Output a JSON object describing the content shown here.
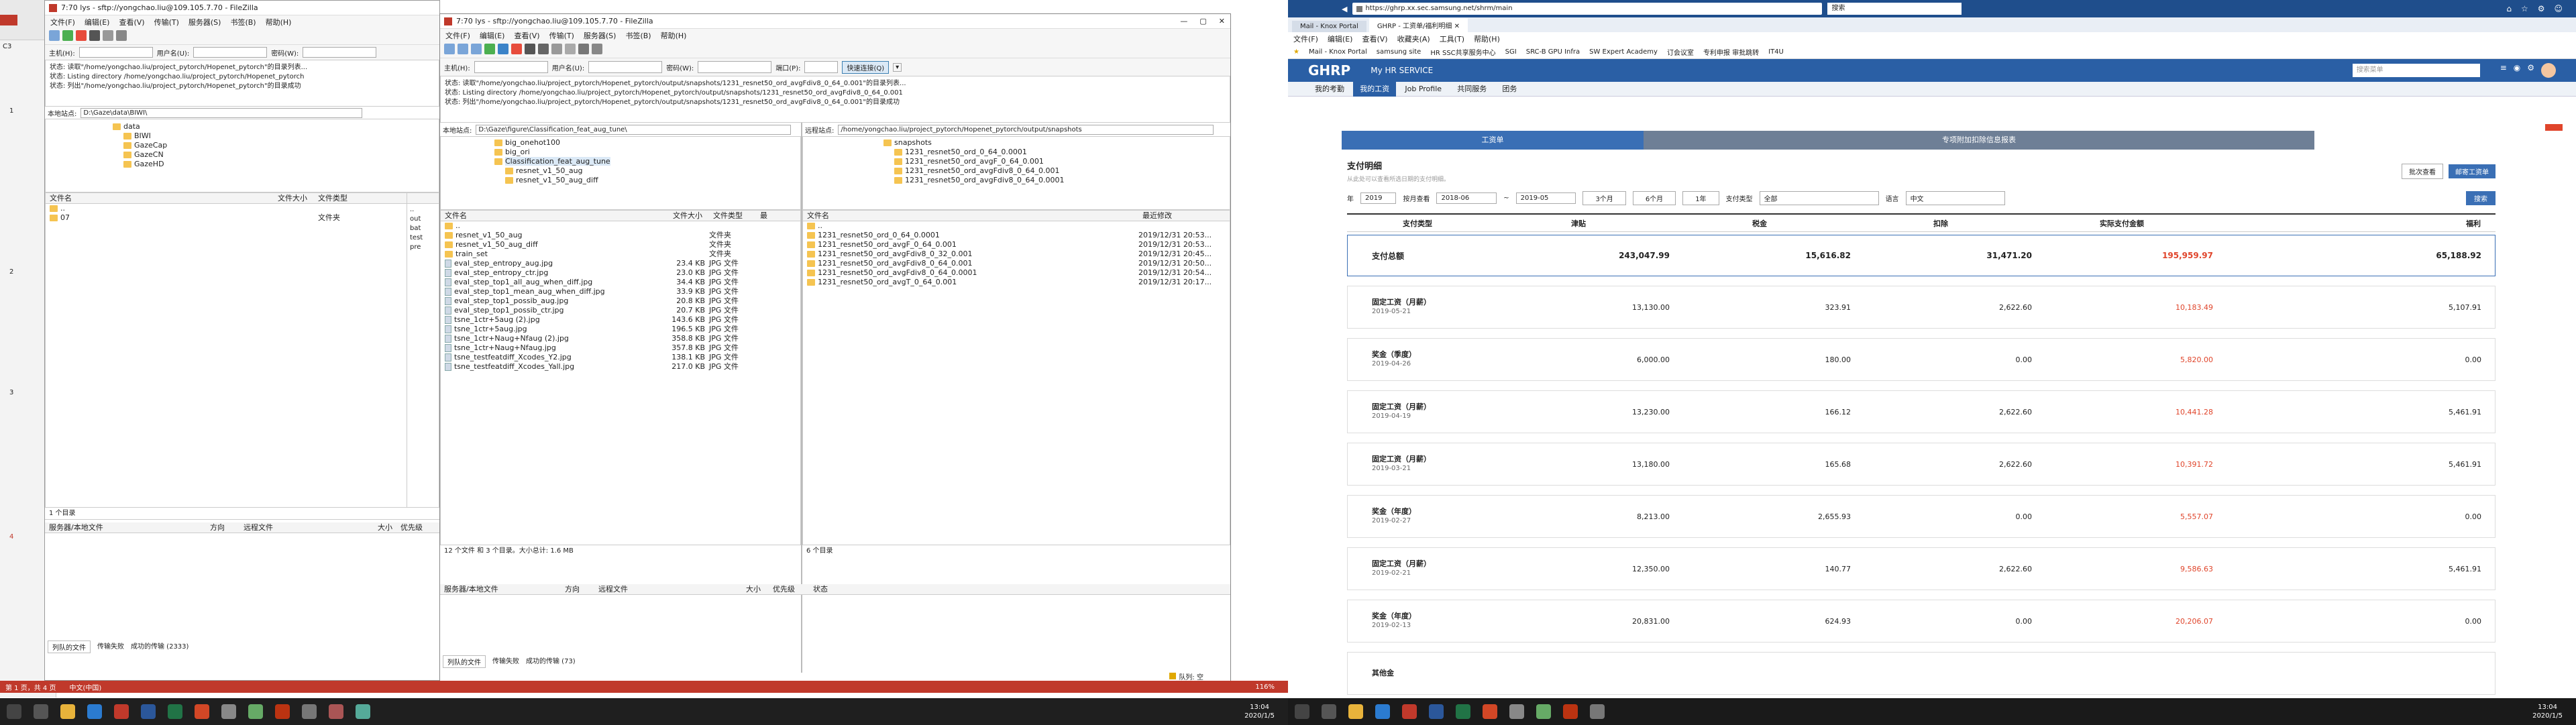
{
  "left": {
    "titlebar": "7:70 lys - sftp://yongchao.liu@109.105.7.70 - FileZilla",
    "menu": [
      "文件(F)",
      "编辑(E)",
      "查看(V)",
      "传输(T)",
      "服务器(S)",
      "书签(B)",
      "帮助(H)"
    ],
    "host_label": "主机(H):",
    "user_label": "用户名(U):",
    "pass_label": "密码(W):",
    "log": [
      "状态: 读取\"/home/yongchao.liu/project_pytorch/Hopenet_pytorch\"的目录列表...",
      "状态: Listing directory /home/yongchao.liu/project_pytorch/Hopenet_pytorch",
      "状态: 列出\"/home/yongchao.liu/project_pytorch/Hopenet_pytorch\"的目录成功"
    ],
    "local_site_label": "本地站点:",
    "local_site": "D:\\Gaze\\data\\BIWI\\",
    "tree": [
      "data",
      "BIWI",
      "GazeCap",
      "GazeCN",
      "GazeHD"
    ],
    "cols": [
      "文件名",
      "文件大小",
      "文件类型"
    ],
    "files": [
      {
        "name": "..",
        "type": ""
      },
      {
        "name": "07",
        "type": "文件夹"
      }
    ],
    "status": "1 个目录",
    "queue": [
      "服务器/本地文件",
      "方向",
      "远程文件",
      "大小",
      "优先级"
    ],
    "tabs": [
      "列队的文件",
      "传输失败",
      "成功的传输 (2333)"
    ],
    "remote_cols": [
      "文件名"
    ],
    "remote_items": [
      "..",
      "out",
      "bat",
      "test",
      "pre"
    ]
  },
  "mid": {
    "titlebar": "7:70 lys - sftp://yongchao.liu@109.105.7.70 - FileZilla",
    "window_controls": [
      "—",
      "▢",
      "✕"
    ],
    "menu": [
      "文件(F)",
      "编辑(E)",
      "查看(V)",
      "传输(T)",
      "服务器(S)",
      "书签(B)",
      "帮助(H)"
    ],
    "host_label": "主机(H):",
    "user_label": "用户名(U):",
    "pass_label": "密码(W):",
    "port_label": "端口(P):",
    "quick_btn": "快速连接(Q)",
    "log": [
      "状态: 读取\"/home/yongchao.liu/project_pytorch/Hopenet_pytorch/output/snapshots/1231_resnet50_ord_avgFdiv8_0_64_0.001\"的目录列表...",
      "状态: Listing directory /home/yongchao.liu/project_pytorch/Hopenet_pytorch/output/snapshots/1231_resnet50_ord_avgFdiv8_0_64_0.001",
      "状态: 列出\"/home/yongchao.liu/project_pytorch/Hopenet_pytorch/output/snapshots/1231_resnet50_ord_avgFdiv8_0_64_0.001\"的目录成功"
    ],
    "local_site_label": "本地站点:",
    "local_site": "D:\\Gaze\\figure\\Classification_feat_aug_tune\\",
    "remote_site_label": "远程站点:",
    "remote_site": "/home/yongchao.liu/project_pytorch/Hopenet_pytorch/output/snapshots",
    "local_tree": [
      "big_onehot100",
      "big_ori",
      "Classification_feat_aug_tune",
      "resnet_v1_50_aug",
      "resnet_v1_50_aug_diff"
    ],
    "remote_tree": [
      "snapshots",
      "1231_resnet50_ord_0_64_0.0001",
      "1231_resnet50_ord_avgF_0_64_0.001",
      "1231_resnet50_ord_avgFdiv8_0_64_0.001",
      "1231_resnet50_ord_avgFdiv8_0_64_0.0001"
    ],
    "local_cols": [
      "文件名",
      "文件大小",
      "文件类型",
      "最"
    ],
    "local_files": [
      {
        "name": "..",
        "size": "",
        "type": "",
        "kind": "folder"
      },
      {
        "name": "resnet_v1_50_aug",
        "size": "",
        "type": "文件夹",
        "kind": "folder"
      },
      {
        "name": "resnet_v1_50_aug_diff",
        "size": "",
        "type": "文件夹",
        "kind": "folder"
      },
      {
        "name": "train_set",
        "size": "",
        "type": "文件夹",
        "kind": "folder"
      },
      {
        "name": "eval_step_entropy_aug.jpg",
        "size": "23.4 KB",
        "type": "JPG 文件",
        "kind": "file"
      },
      {
        "name": "eval_step_entropy_ctr.jpg",
        "size": "23.0 KB",
        "type": "JPG 文件",
        "kind": "file"
      },
      {
        "name": "eval_step_top1_all_aug_when_diff.jpg",
        "size": "34.4 KB",
        "type": "JPG 文件",
        "kind": "file"
      },
      {
        "name": "eval_step_top1_mean_aug_when_diff.jpg",
        "size": "33.9 KB",
        "type": "JPG 文件",
        "kind": "file"
      },
      {
        "name": "eval_step_top1_possib_aug.jpg",
        "size": "20.8 KB",
        "type": "JPG 文件",
        "kind": "file"
      },
      {
        "name": "eval_step_top1_possib_ctr.jpg",
        "size": "20.7 KB",
        "type": "JPG 文件",
        "kind": "file"
      },
      {
        "name": "tsne_1ctr+5aug (2).jpg",
        "size": "143.6 KB",
        "type": "JPG 文件",
        "kind": "file"
      },
      {
        "name": "tsne_1ctr+5aug.jpg",
        "size": "196.5 KB",
        "type": "JPG 文件",
        "kind": "file"
      },
      {
        "name": "tsne_1ctr+Naug+Nfaug (2).jpg",
        "size": "358.8 KB",
        "type": "JPG 文件",
        "kind": "file"
      },
      {
        "name": "tsne_1ctr+Naug+Nfaug.jpg",
        "size": "357.8 KB",
        "type": "JPG 文件",
        "kind": "file"
      },
      {
        "name": "tsne_testfeatdiff_Xcodes_Y2.jpg",
        "size": "138.1 KB",
        "type": "JPG 文件",
        "kind": "file"
      },
      {
        "name": "tsne_testfeatdiff_Xcodes_Yall.jpg",
        "size": "217.0 KB",
        "type": "JPG 文件",
        "kind": "file"
      }
    ],
    "remote_cols": [
      "文件名",
      "最近修改"
    ],
    "remote_files": [
      {
        "name": "..",
        "date": ""
      },
      {
        "name": "1231_resnet50_ord_0_64_0.0001",
        "date": "2019/12/31 20:53..."
      },
      {
        "name": "1231_resnet50_ord_avgF_0_64_0.001",
        "date": "2019/12/31 20:53..."
      },
      {
        "name": "1231_resnet50_ord_avgFdiv8_0_32_0.001",
        "date": "2019/12/31 20:45..."
      },
      {
        "name": "1231_resnet50_ord_avgFdiv8_0_64_0.001",
        "date": "2019/12/31 20:50..."
      },
      {
        "name": "1231_resnet50_ord_avgFdiv8_0_64_0.0001",
        "date": "2019/12/31 20:54..."
      },
      {
        "name": "1231_resnet50_ord_avgT_0_64_0.001",
        "date": "2019/12/31 20:17..."
      }
    ],
    "local_status": "12 个文件 和 3 个目录。大小总计: 1.6 MB",
    "remote_status": "6 个目录",
    "queue": [
      "服务器/本地文件",
      "方向",
      "远程文件",
      "大小",
      "优先级",
      "状态"
    ],
    "tabs": [
      "列队的文件",
      "传输失败",
      "成功的传输 (73)"
    ],
    "queue_status": "队列: 空"
  },
  "excel": {
    "cell": "C3",
    "rows": [
      "1",
      "2",
      "3",
      "4"
    ],
    "status_left": "第 1 页，共 4 页",
    "status_lang": "中文(中国)",
    "zoom": "116%"
  },
  "browser": {
    "url": "https://ghrp.xx.sec.samsung.net/shrm/main",
    "search_placeholder": "搜索",
    "tabs": [
      "Mail - Knox Portal",
      "GHRP - 工资单/福利明细"
    ],
    "menu": [
      "文件(F)",
      "编辑(E)",
      "查看(V)",
      "收藏夹(A)",
      "工具(T)",
      "帮助(H)"
    ],
    "favorites": [
      "Mail - Knox Portal",
      "samsung site",
      "HR SSC共享服务中心",
      "SGI",
      "SRC-B GPU Infra",
      "SW Expert Academy",
      "订会议室",
      "专利申报 审批跳转",
      "IT4U"
    ],
    "logo": "GHRP",
    "service": "My HR SERVICE",
    "search_label": "搜索菜单",
    "nav": [
      "我的考勤",
      "我的工资",
      "Job Profile",
      "共同服务",
      "团务"
    ],
    "tab_pay": "工资单",
    "tab_special": "专项附加扣除信息报表",
    "section_title": "支付明细",
    "section_desc": "从此处可以查看所选日期的支付明细。",
    "btn_batch": "批次查看",
    "btn_send": "邮寄工资单",
    "year_label": "年",
    "year": "2019",
    "period_label": "按月查看",
    "from": "2018-06",
    "to": "2019-05",
    "quick": [
      "3个月",
      "6个月",
      "1年"
    ],
    "type_label": "支付类型",
    "type": "全部",
    "lang_label": "语言",
    "lang": "中文",
    "search_btn": "搜索",
    "cols": [
      "支付类型",
      "津贴",
      "税金",
      "扣除",
      "实际支付金额",
      "福利"
    ],
    "total": {
      "label": "支付总额",
      "allowance": "243,047.99",
      "tax": "15,616.82",
      "deduct": "31,471.20",
      "actual": "195,959.97",
      "welfare": "65,188.92"
    },
    "rows": [
      {
        "type": "固定工资（月薪）",
        "date": "2019-05-21",
        "allowance": "13,130.00",
        "tax": "323.91",
        "deduct": "2,622.60",
        "actual": "10,183.49",
        "welfare": "5,107.91"
      },
      {
        "type": "奖金（季度）",
        "date": "2019-04-26",
        "allowance": "6,000.00",
        "tax": "180.00",
        "deduct": "0.00",
        "actual": "5,820.00",
        "welfare": "0.00"
      },
      {
        "type": "固定工资（月薪）",
        "date": "2019-04-19",
        "allowance": "13,230.00",
        "tax": "166.12",
        "deduct": "2,622.60",
        "actual": "10,441.28",
        "welfare": "5,461.91"
      },
      {
        "type": "固定工资（月薪）",
        "date": "2019-03-21",
        "allowance": "13,180.00",
        "tax": "165.68",
        "deduct": "2,622.60",
        "actual": "10,391.72",
        "welfare": "5,461.91"
      },
      {
        "type": "奖金（年度）",
        "date": "2019-02-27",
        "allowance": "8,213.00",
        "tax": "2,655.93",
        "deduct": "0.00",
        "actual": "5,557.07",
        "welfare": "0.00"
      },
      {
        "type": "固定工资（月薪）",
        "date": "2019-02-21",
        "allowance": "12,350.00",
        "tax": "140.77",
        "deduct": "2,622.60",
        "actual": "9,586.63",
        "welfare": "5,461.91"
      },
      {
        "type": "奖金（年度）",
        "date": "2019-02-13",
        "allowance": "20,831.00",
        "tax": "624.93",
        "deduct": "0.00",
        "actual": "20,206.07",
        "welfare": "0.00"
      },
      {
        "type": "其他金",
        "date": "",
        "allowance": "",
        "tax": "",
        "deduct": "",
        "actual": "",
        "welfare": ""
      }
    ]
  },
  "taskbar_left": {
    "time": "13:04",
    "date": "2020/1/5"
  },
  "taskbar_right": {
    "time": "13:04",
    "date": "2020/1/5"
  },
  "colors": {
    "accent": "#1a73c8",
    "red": "#e0452b",
    "ghrp_nav": "#2a5fa5"
  }
}
